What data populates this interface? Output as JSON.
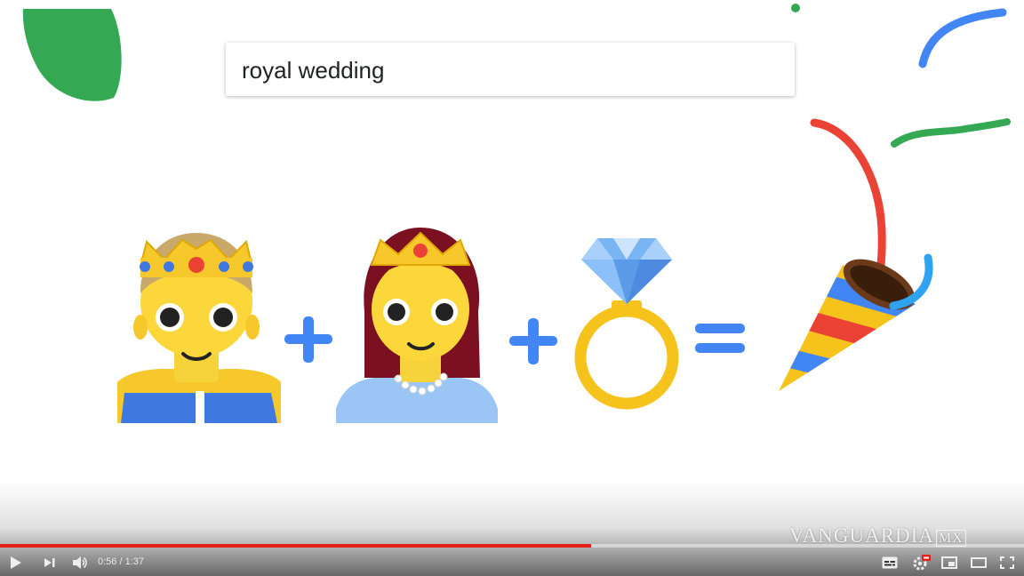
{
  "search": {
    "query": "royal wedding"
  },
  "equation": {
    "items": [
      "prince-emoji",
      "plus-icon",
      "princess-emoji",
      "plus-icon",
      "ring-emoji",
      "equals-icon",
      "party-popper-emoji"
    ]
  },
  "player": {
    "current_time": "0:56",
    "separator": "/",
    "duration": "1:37",
    "progress": 0.577,
    "progress_color": "#e62117",
    "icons": [
      "play-icon",
      "next-icon",
      "volume-icon",
      "subtitles-icon",
      "settings-icon",
      "miniplayer-icon",
      "theater-icon",
      "fullscreen-icon"
    ]
  },
  "watermark": {
    "text": "VANGUARDIA",
    "suffix": "MX"
  },
  "colors": {
    "google_green": "#34a853",
    "google_blue": "#4285f4",
    "google_red": "#ea4335",
    "google_yellow": "#fbbc05"
  }
}
